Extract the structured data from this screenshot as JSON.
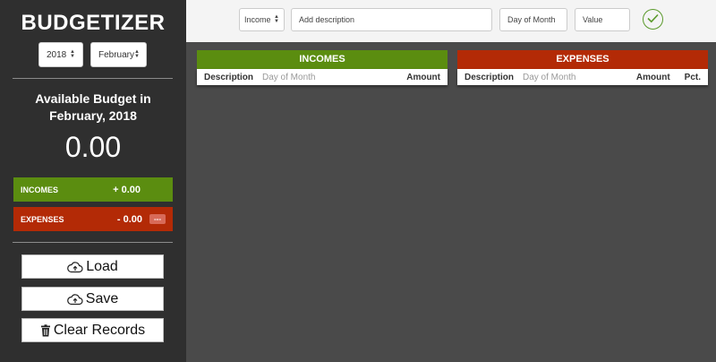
{
  "app": {
    "title": "BUDGETIZER"
  },
  "sidebar": {
    "year": "2018",
    "month": "February",
    "budget_label_line1": "Available Budget in",
    "budget_label_line2": "February, 2018",
    "budget_value": "0.00",
    "incomes_label": "INCOMES",
    "incomes_value": "+ 0.00",
    "expenses_label": "EXPENSES",
    "expenses_value": "- 0.00",
    "expenses_pct": "---",
    "load_label": "Load",
    "save_label": "Save",
    "clear_label": "Clear Records"
  },
  "topbar": {
    "type_value": "Income",
    "description_placeholder": "Add description",
    "day_placeholder": "Day of Month",
    "value_placeholder": "Value"
  },
  "incomes_panel": {
    "title": "INCOMES",
    "columns": [
      "Description",
      "Day of Month",
      "Amount"
    ]
  },
  "expenses_panel": {
    "title": "EXPENSES",
    "columns": [
      "Description",
      "Day of Month",
      "Amount",
      "Pct."
    ]
  },
  "colors": {
    "income": "#5b8d10",
    "expense": "#b32a06",
    "sidebar": "#2f2f2f",
    "check": "#5b9a2c"
  }
}
